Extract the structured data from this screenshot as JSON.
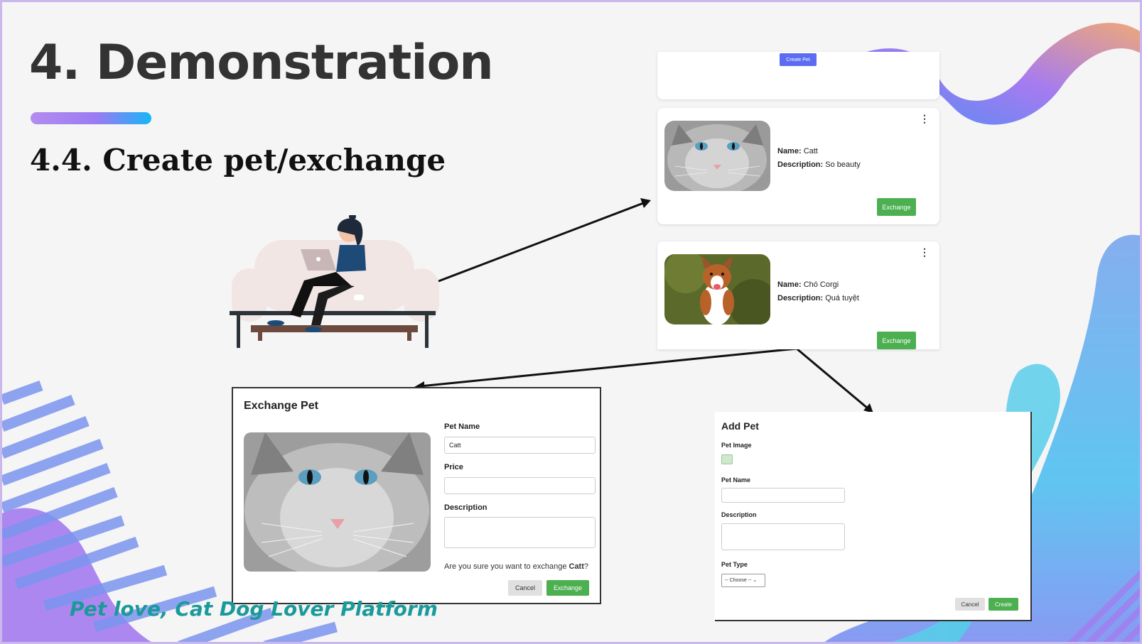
{
  "slide": {
    "title": "4. Demonstration",
    "subtitle": "4.4. Create pet/exchange",
    "footer": "Pet love, Cat Dog Lover Platform"
  },
  "colors": {
    "accent_purple": "#a27bf0",
    "accent_blue": "#16b6f7",
    "button_green": "#4caf50",
    "button_indigo": "#5b6cf2",
    "footer_teal": "#1a9a9a"
  },
  "pet_list": {
    "create_button": "Create Pet",
    "name_label": "Name:",
    "description_label": "Description:",
    "menu_icon": "kebab-menu-icon",
    "pets": [
      {
        "name": "Catt",
        "description": "So beauty",
        "exchange_label": "Exchange",
        "photo": "gray-cat-photo"
      },
      {
        "name": "Chó Corgi",
        "description": "Quá tuyệt",
        "exchange_label": "Exchange",
        "photo": "corgi-dog-photo"
      }
    ]
  },
  "exchange_modal": {
    "title": "Exchange Pet",
    "pet_name_label": "Pet Name",
    "pet_name_value": "Catt",
    "price_label": "Price",
    "price_value": "",
    "description_label": "Description",
    "description_value": "",
    "confirm_prefix": "Are you sure you want to exchange ",
    "confirm_pet": "Catt",
    "confirm_suffix": "?",
    "cancel_label": "Cancel",
    "exchange_label": "Exchange"
  },
  "add_modal": {
    "title": "Add Pet",
    "image_label": "Pet Image",
    "image_icon": "image-placeholder-icon",
    "pet_name_label": "Pet Name",
    "description_label": "Description",
    "pet_type_label": "Pet Type",
    "pet_type_selected": "-- Choose --",
    "cancel_label": "Cancel",
    "create_label": "Create"
  }
}
